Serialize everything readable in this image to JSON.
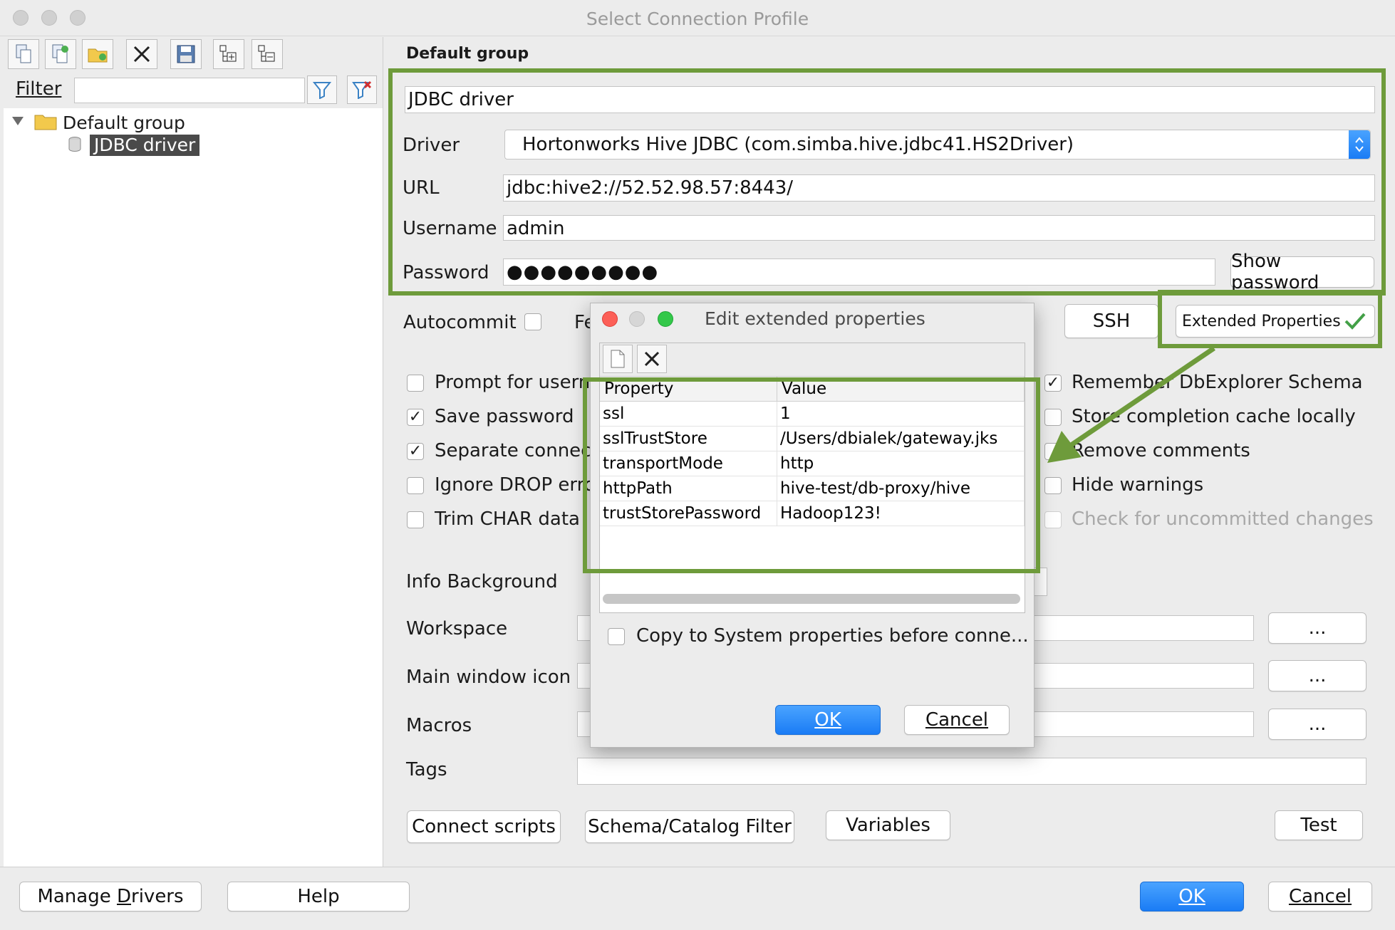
{
  "window": {
    "title": "Select Connection Profile"
  },
  "left": {
    "filter_label": "Filter",
    "filter_value": "",
    "tree": {
      "group": "Default group",
      "item": "JDBC driver"
    }
  },
  "profile": {
    "group_title": "Default group",
    "name": "JDBC driver",
    "driver_label": "Driver",
    "driver_value": "Hortonworks Hive JDBC (com.simba.hive.jdbc41.HS2Driver)",
    "url_label": "URL",
    "url_value": "jdbc:hive2://52.52.98.57:8443/",
    "username_label": "Username",
    "username_value": "admin",
    "password_label": "Password",
    "password_value": "●●●●●●●●●",
    "show_password": "Show password",
    "autocommit": "Autocommit",
    "fe_partial": "Fe",
    "ssh": "SSH",
    "extended_properties": "Extended Properties"
  },
  "options_left": [
    {
      "label": "Prompt for usern",
      "checked": false
    },
    {
      "label": "Save password",
      "checked": true
    },
    {
      "label": "Separate connect",
      "checked": true
    },
    {
      "label": "Ignore DROP erro",
      "checked": false
    },
    {
      "label": "Trim CHAR data",
      "checked": false
    }
  ],
  "options_right": [
    {
      "label": "Remember DbExplorer Schema",
      "checked": true
    },
    {
      "label": "Store completion cache locally",
      "checked": false
    },
    {
      "label": "Remove comments",
      "checked": false
    },
    {
      "label": "Hide warnings",
      "checked": false
    },
    {
      "label": "Check for uncommitted changes",
      "checked": false,
      "disabled": true
    }
  ],
  "lower": {
    "info_background": "Info Background",
    "workspace": "Workspace",
    "main_window_icon": "Main window icon",
    "macros": "Macros",
    "tags": "Tags",
    "ellipsis": "..."
  },
  "buttons": {
    "connect_scripts": "Connect scripts",
    "schema_filter": "Schema/Catalog Filter",
    "variables": "Variables",
    "test": "Test",
    "manage_drivers_pre": "Manage ",
    "manage_drivers_u": "D",
    "manage_drivers_post": "rivers",
    "help": "Help",
    "ok": "OK",
    "cancel": "Cancel"
  },
  "dialog": {
    "title": "Edit extended properties",
    "col_property": "Property",
    "col_value": "Value",
    "rows": [
      {
        "property": "ssl",
        "value": "1"
      },
      {
        "property": "sslTrustStore",
        "value": "/Users/dbialek/gateway.jks"
      },
      {
        "property": "transportMode",
        "value": "http"
      },
      {
        "property": "httpPath",
        "value": "hive-test/db-proxy/hive"
      },
      {
        "property": "trustStorePassword",
        "value": "Hadoop123!"
      }
    ],
    "copy_label": "Copy to System properties before conne...",
    "ok": "OK",
    "cancel": "Cancel"
  },
  "colors": {
    "highlight_green": "#6e9b3b",
    "primary_blue": "#1a7cf5",
    "tree_selection": "#4a4a4a"
  }
}
